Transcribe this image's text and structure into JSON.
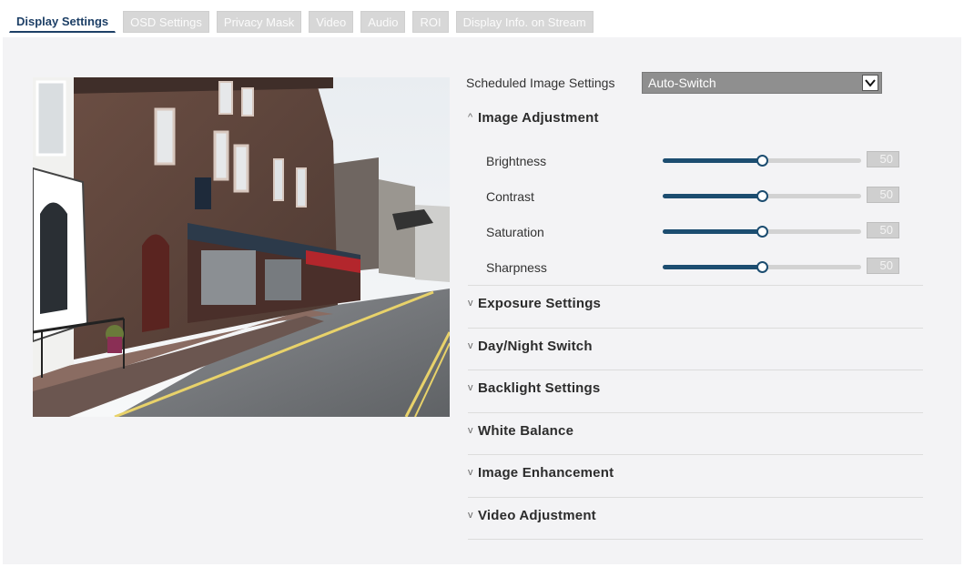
{
  "tabs": [
    {
      "label": "Display Settings",
      "active": true
    },
    {
      "label": "OSD Settings",
      "active": false
    },
    {
      "label": "Privacy Mask",
      "active": false
    },
    {
      "label": "Video",
      "active": false
    },
    {
      "label": "Audio",
      "active": false
    },
    {
      "label": "ROI",
      "active": false
    },
    {
      "label": "Display Info. on Stream",
      "active": false
    }
  ],
  "schedule": {
    "label": "Scheduled Image Settings",
    "value": "Auto-Switch"
  },
  "image_adjustment": {
    "title": "Image Adjustment",
    "sliders": [
      {
        "label": "Brightness",
        "value": "50",
        "level": 0.5
      },
      {
        "label": "Contrast",
        "value": "50",
        "level": 0.5
      },
      {
        "label": "Saturation",
        "value": "50",
        "level": 0.5
      },
      {
        "label": "Sharpness",
        "value": "50",
        "level": 0.5
      }
    ]
  },
  "sections": [
    "Exposure Settings",
    "Day/Night Switch",
    "Backlight Settings",
    "White Balance",
    "Image Enhancement",
    "Video Adjustment"
  ],
  "colors": {
    "accent": "#1c4d70",
    "tab_active_text": "#1d3f66",
    "panel_bg": "#f3f3f5"
  },
  "icons": {
    "expanded": "chevron-up-icon",
    "collapsed": "chevron-down-icon",
    "dropdown": "dropdown-arrow-icon"
  }
}
